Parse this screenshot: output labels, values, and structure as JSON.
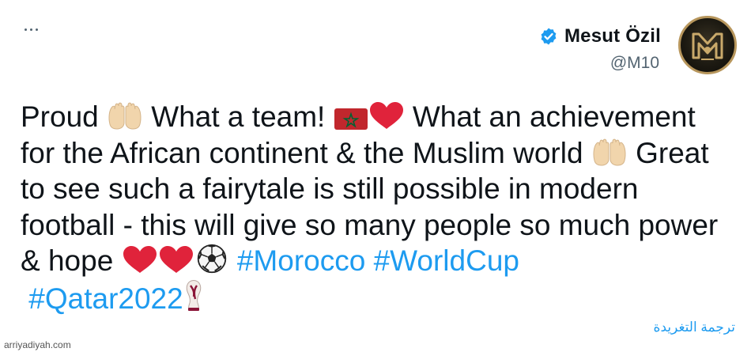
{
  "tweet": {
    "more_icon": "more-horizontal-icon",
    "author": {
      "display_name": "Mesut Özil",
      "handle": "@M10",
      "verified_icon": "verified-badge-icon",
      "avatar_icon": "m10-logo-avatar"
    },
    "text": {
      "line1_a": "Proud ",
      "line1_b": " What a team! ",
      "line1_c": " What an achievement",
      "line2_a": "for the African continent & the Muslim world ",
      "line2_b": " Great",
      "line3": "to see such a fairytale is still possible in modern",
      "line4": "football - this will give so many people so much power",
      "line5_a": "& hope ",
      "hashtags": [
        "#Morocco",
        "#WorldCup",
        "#Qatar2022"
      ]
    },
    "emojis": [
      "raising-hands-icon",
      "morocco-flag-icon",
      "red-heart-icon",
      "soccer-ball-icon",
      "world-cup-trophy-icon"
    ],
    "translate_label": "ترجمة التغريدة"
  },
  "watermark": "arriyadiyah.com",
  "colors": {
    "text": "#0f1419",
    "secondary": "#536471",
    "link": "#1d9bf0",
    "verified": "#1d9bf0",
    "heart": "#e0233b",
    "flag_red": "#c1272d",
    "flag_star": "#006233",
    "avatar_gold": "#b7965c"
  }
}
